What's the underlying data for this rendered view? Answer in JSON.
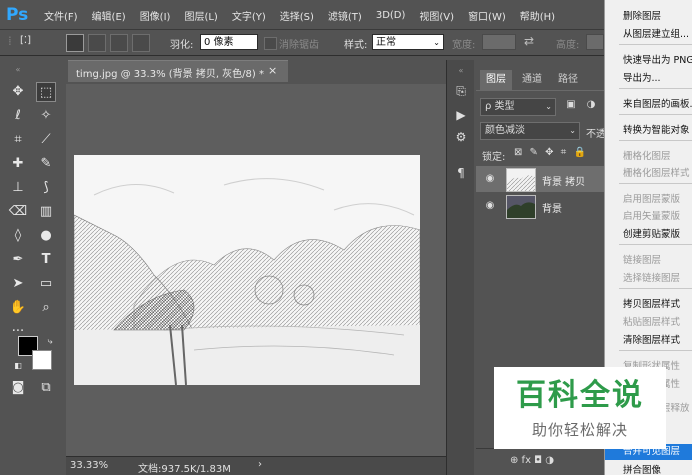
{
  "app": {
    "logo": "Ps"
  },
  "menubar": {
    "items": [
      "文件(F)",
      "编辑(E)",
      "图像(I)",
      "图层(L)",
      "文字(Y)",
      "选择(S)",
      "滤镜(T)",
      "3D(D)",
      "视图(V)",
      "窗口(W)",
      "帮助(H)"
    ]
  },
  "options": {
    "marquee_glyph": "[⁚]",
    "feather_label": "羽化:",
    "feather_value": "0 像素",
    "antialias_label": "消除锯齿",
    "style_label": "样式:",
    "style_value": "正常",
    "width_label": "宽度:",
    "height_label": "高度:"
  },
  "document": {
    "tab_title": "timg.jpg @ 33.3% (背景 拷贝, 灰色/8) *",
    "close_glyph": "×",
    "zoom": "33.33%",
    "doc_info": "文档:937.5K/1.83M",
    "status_arrow": "›"
  },
  "layers_panel": {
    "tabs": [
      "图层",
      "通道",
      "路径"
    ],
    "filter_label": "ρ 类型",
    "blend_mode": "颜色减淡",
    "opacity_label": "不透",
    "lock_label": "锁定:",
    "lock_icons": "⊠ ✎ ✥ ⌗ 🔒",
    "layers": [
      {
        "name": "背景 拷贝",
        "selected": true
      },
      {
        "name": "背景",
        "selected": false
      }
    ],
    "footer_icons": "⊕  fx  ◘  ◑"
  },
  "context_menu": {
    "items": [
      {
        "label": "删除图层",
        "disabled": false
      },
      {
        "label": "从图层建立组...",
        "disabled": false
      },
      {
        "label": "快速导出为 PNG",
        "disabled": false
      },
      {
        "label": "导出为...",
        "disabled": false
      },
      {
        "label": "来自图层的画板...",
        "disabled": false
      },
      {
        "label": "转换为智能对象",
        "disabled": false
      },
      {
        "label": "栅格化图层",
        "disabled": true
      },
      {
        "label": "栅格化图层样式",
        "disabled": true
      },
      {
        "label": "启用图层蒙版",
        "disabled": true
      },
      {
        "label": "启用矢量蒙版",
        "disabled": true
      },
      {
        "label": "创建剪贴蒙版",
        "disabled": false
      },
      {
        "label": "链接图层",
        "disabled": true
      },
      {
        "label": "选择链接图层",
        "disabled": true
      },
      {
        "label": "拷贝图层样式",
        "disabled": false
      },
      {
        "label": "粘贴图层样式",
        "disabled": true
      },
      {
        "label": "清除图层样式",
        "disabled": false
      },
      {
        "label": "复制形状属性",
        "disabled": true
      },
      {
        "label": "粘贴形状属性",
        "disabled": true
      },
      {
        "label": "从隔离图层释放",
        "disabled": true
      },
      {
        "label": "合并可见图层",
        "disabled": false,
        "highlighted": true
      },
      {
        "label": "拼合图像",
        "disabled": false
      }
    ]
  },
  "watermark": {
    "title": "百科全说",
    "subtitle": "助你轻松解决"
  },
  "colors": {
    "accent": "#1f7adb",
    "ps_blue": "#31a8ff",
    "watermark_green": "#2e9b4a"
  }
}
